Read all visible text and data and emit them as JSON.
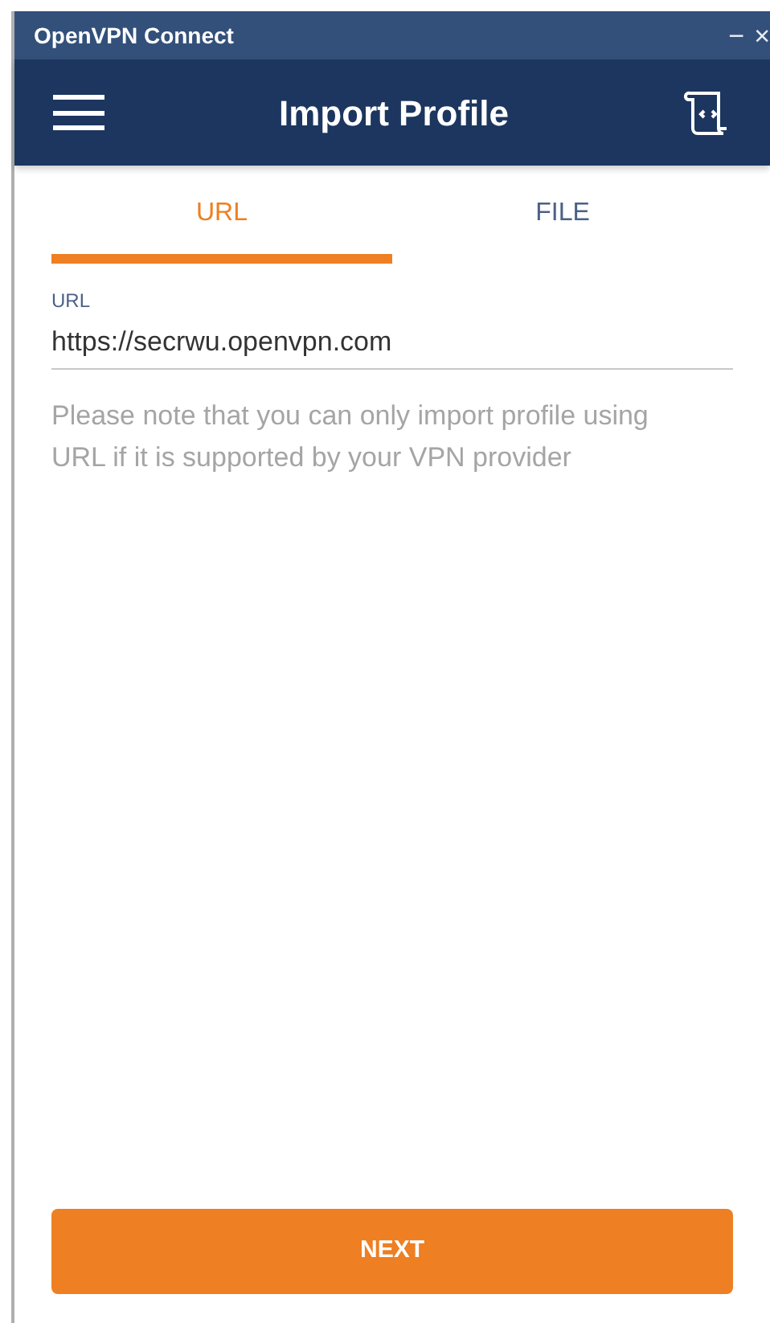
{
  "window": {
    "title": "OpenVPN Connect",
    "controls": [
      "−",
      "×"
    ]
  },
  "header": {
    "title": "Import Profile"
  },
  "tabs": [
    {
      "label": "URL",
      "selected": true
    },
    {
      "label": "FILE",
      "selected": false
    }
  ],
  "url_field": {
    "label": "URL",
    "value": "https://secrwu.openvpn.com"
  },
  "note": "Please note that you can only import profile using URL if it is supported by your VPN provider",
  "buttons": [
    "NEXT"
  ]
}
